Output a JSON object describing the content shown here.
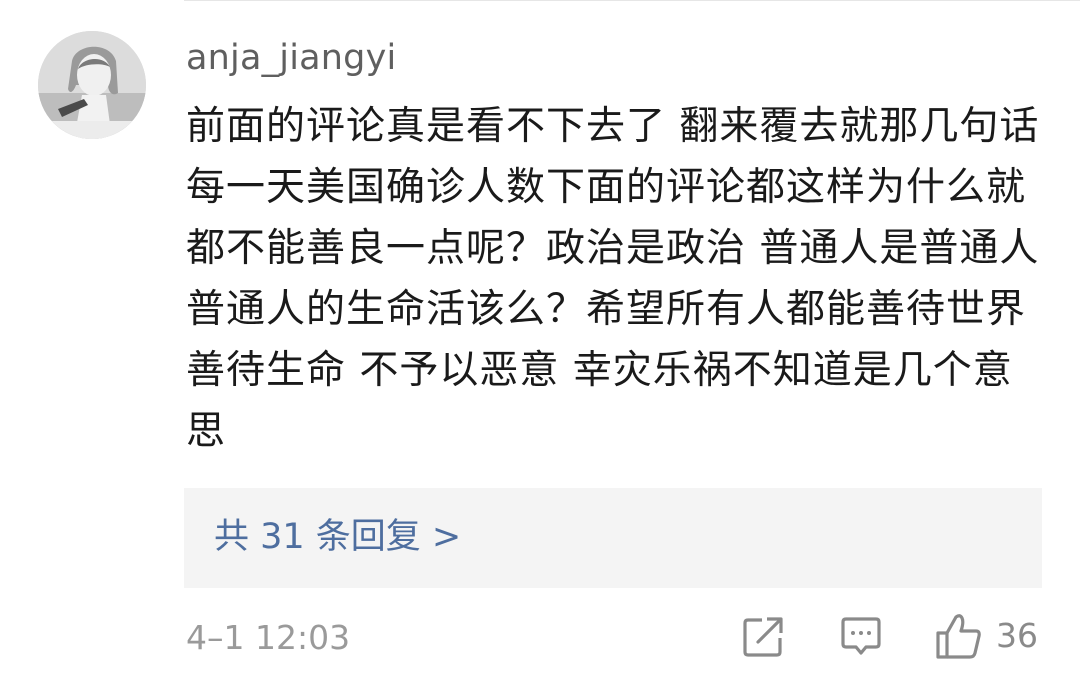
{
  "comment": {
    "username": "anja_jiangyi",
    "avatar_icon": "user-avatar-photo",
    "text": "前面的评论真是看不下去了 翻来覆去就那几句话 每一天美国确诊人数下面的评论都这样为什么就都不能善良一点呢？政治是政治 普通人是普通人 普通人的生命活该么？希望所有人都能善待世界 善待生命 不予以恶意 幸灾乐祸不知道是几个意思",
    "replies_label": "共 31 条回复 >",
    "timestamp": "4–1 12:03",
    "like_count": "36"
  },
  "actions": {
    "share_icon": "share-icon",
    "reply_icon": "comment-icon",
    "like_icon": "thumbs-up-icon"
  },
  "colors": {
    "link": "#4e6e9f",
    "text": "#1a1a1a",
    "meta": "#9a9a9a",
    "reply_box_bg": "#f4f4f4"
  }
}
